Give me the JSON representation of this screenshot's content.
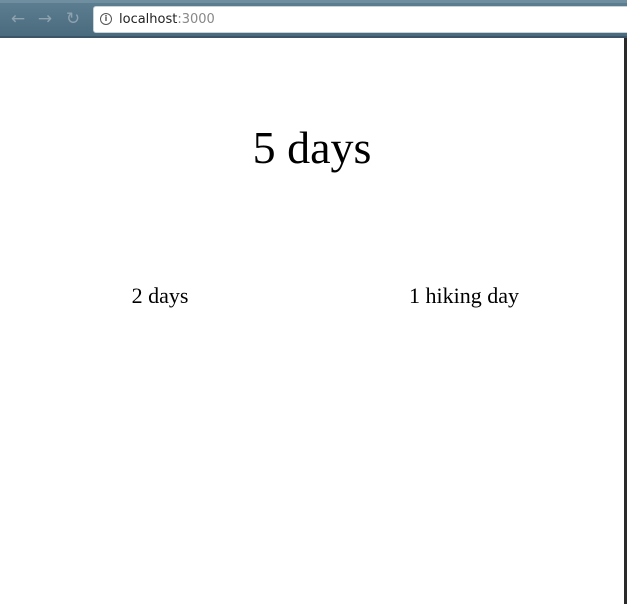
{
  "browser": {
    "address_bar": {
      "host": "localhost",
      "port": ":3000"
    },
    "icons": {
      "back": "back-arrow-icon",
      "forward": "forward-arrow-icon",
      "reload": "reload-icon",
      "info": "info-icon"
    }
  },
  "page": {
    "total_days": "5 days",
    "stats": [
      {
        "label": "2 days"
      },
      {
        "label": "1 hiking day"
      }
    ]
  }
}
